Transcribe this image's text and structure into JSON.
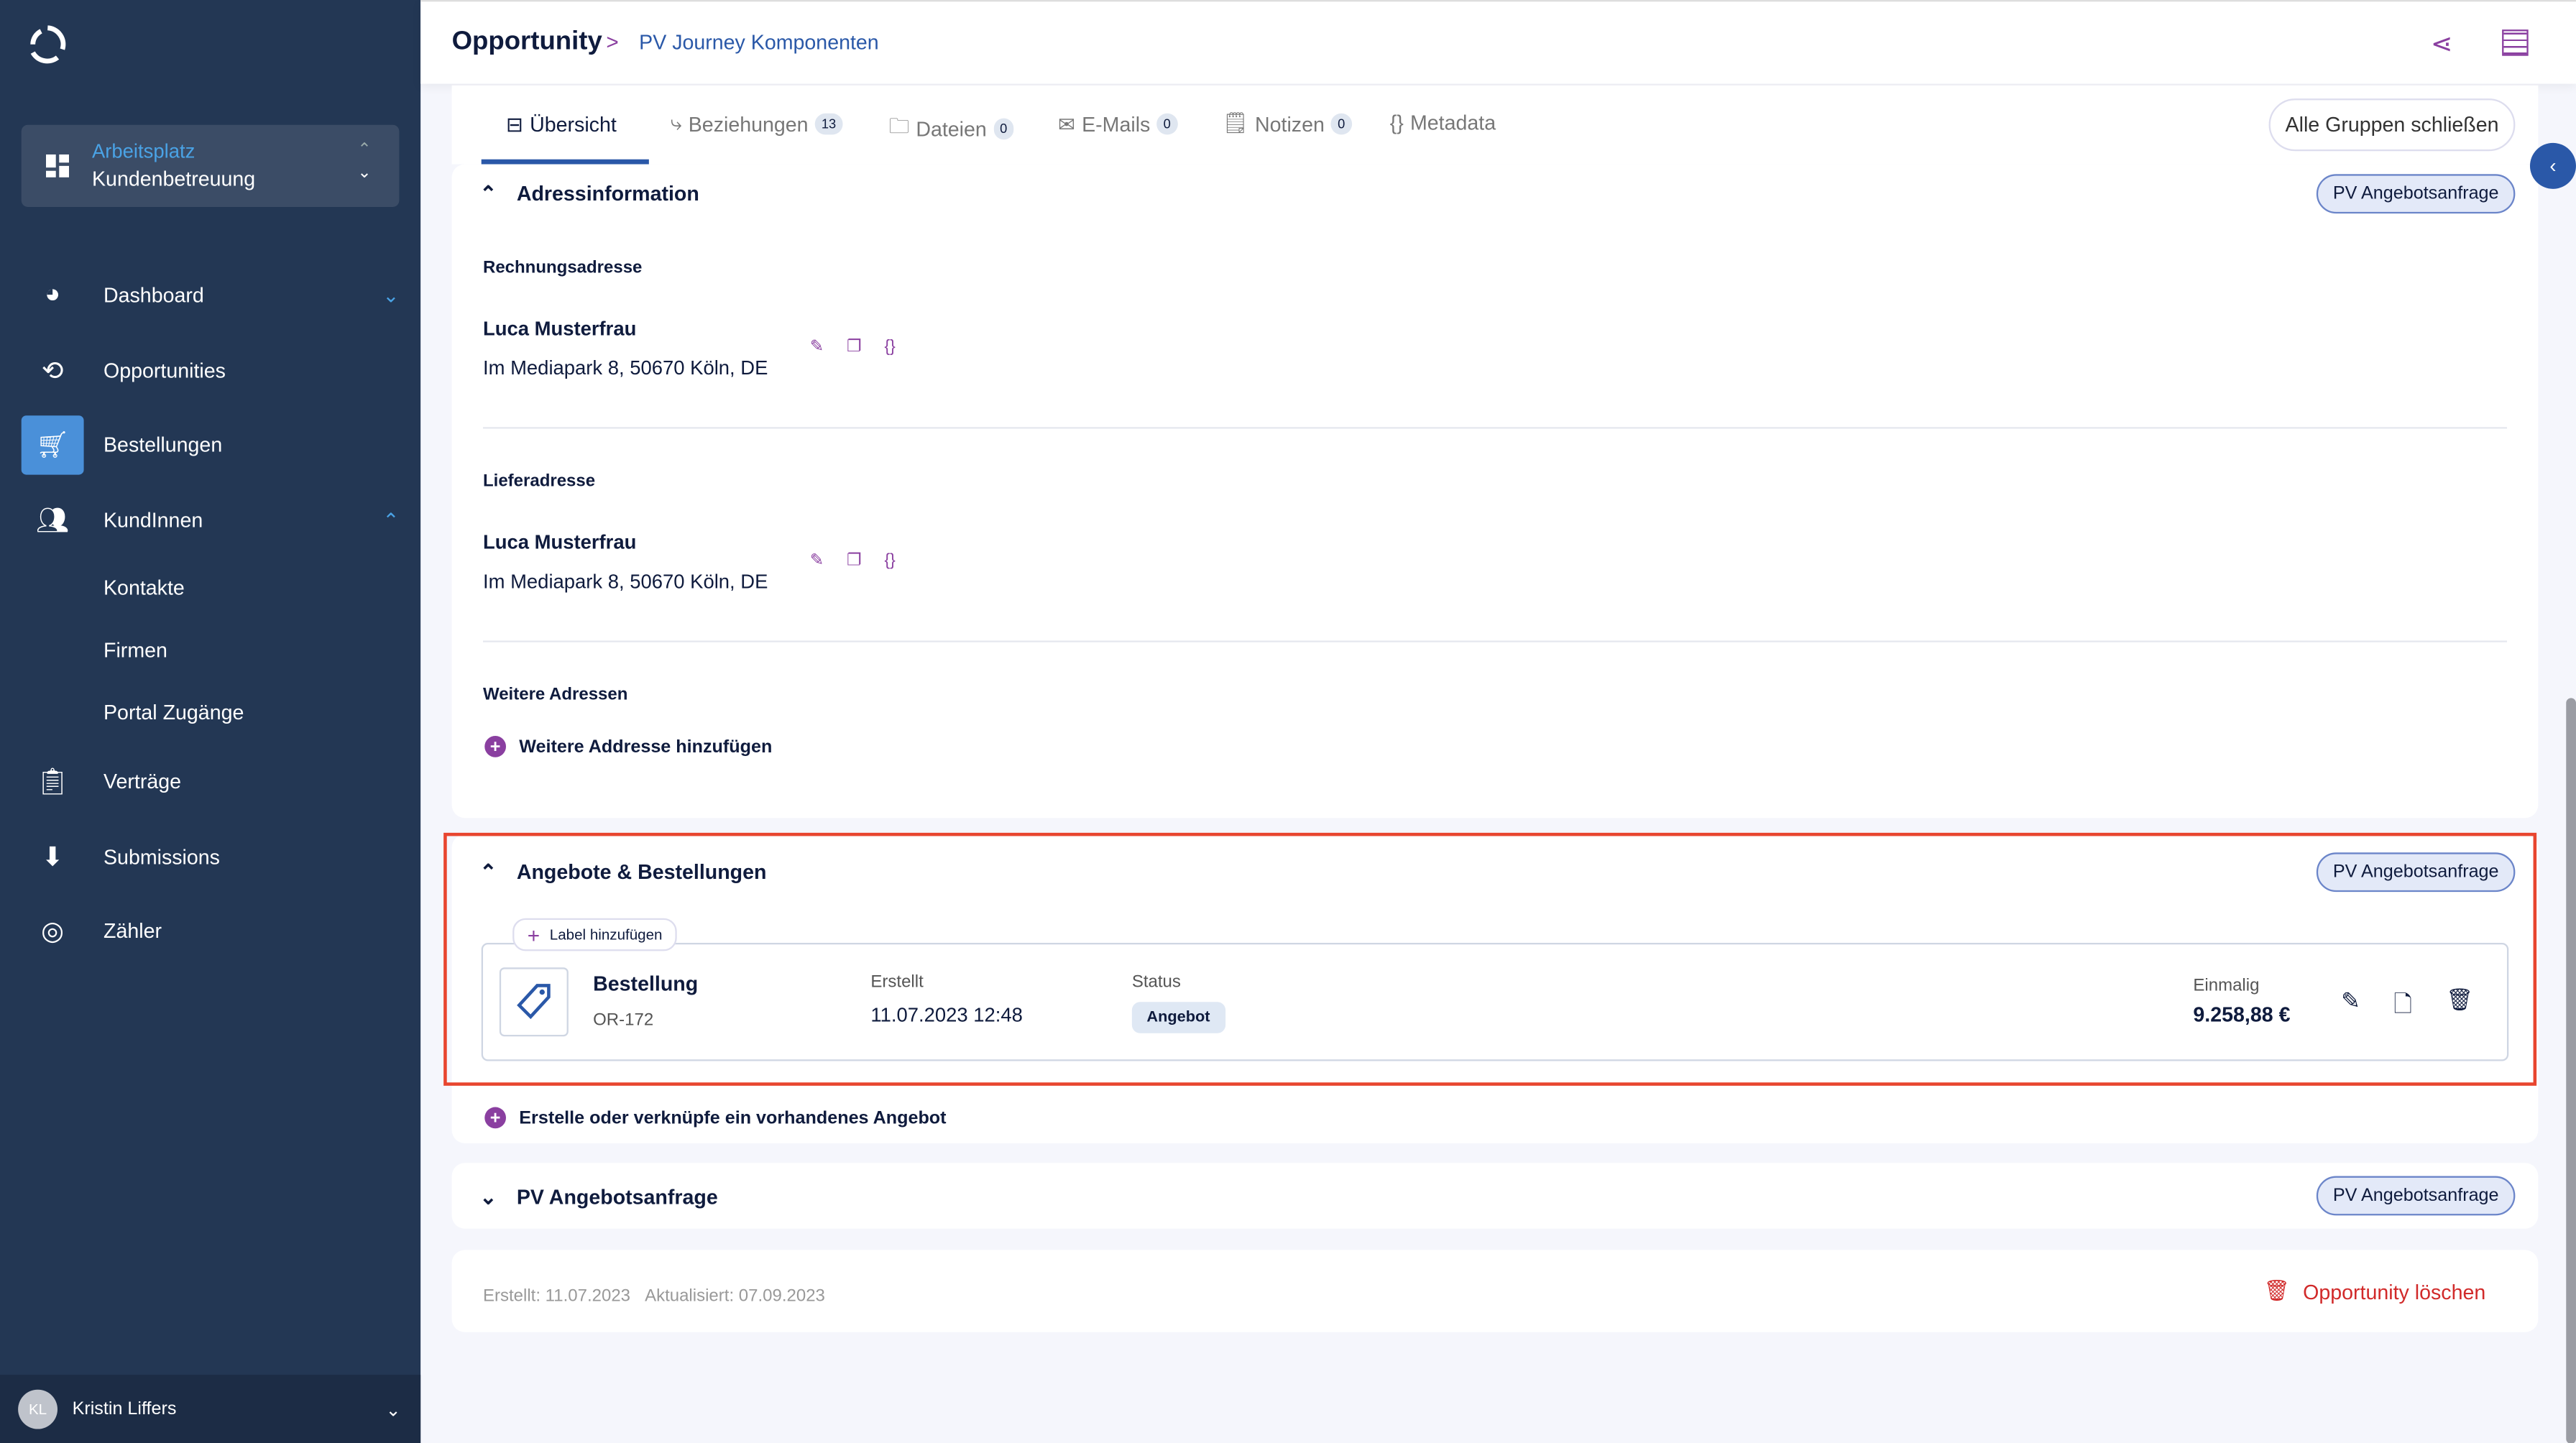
{
  "sidebar": {
    "workspace": {
      "label": "Arbeitsplatz",
      "value": "Kundenbetreuung"
    },
    "items": [
      {
        "label": "Dashboard",
        "icon": "pie-chart-icon"
      },
      {
        "label": "Opportunities",
        "icon": "refresh-icon"
      },
      {
        "label": "Bestellungen",
        "icon": "cart-icon"
      },
      {
        "label": "KundInnen",
        "icon": "users-icon"
      },
      {
        "label": "Verträge",
        "icon": "clipboard-icon"
      },
      {
        "label": "Submissions",
        "icon": "inbox-icon"
      },
      {
        "label": "Zähler",
        "icon": "meter-icon"
      }
    ],
    "subitems": [
      "Kontakte",
      "Firmen",
      "Portal Zugänge"
    ],
    "user": {
      "initials": "KL",
      "name": "Kristin Liffers"
    }
  },
  "header": {
    "breadcrumb_root": "Opportunity",
    "breadcrumb_current": "PV Journey Komponenten"
  },
  "tabs": [
    {
      "label": "Übersicht"
    },
    {
      "label": "Beziehungen",
      "count": "13"
    },
    {
      "label": "Dateien",
      "count": "0"
    },
    {
      "label": "E-Mails",
      "count": "0"
    },
    {
      "label": "Notizen",
      "count": "0"
    },
    {
      "label": "Metadata"
    }
  ],
  "close_groups": "Alle Gruppen schließen",
  "address": {
    "title": "Adressinformation",
    "pill": "PV Angebotsanfrage",
    "billing_label": "Rechnungsadresse",
    "billing_name": "Luca Musterfrau",
    "billing_addr": "Im Mediapark 8, 50670 Köln, DE",
    "delivery_label": "Lieferadresse",
    "delivery_name": "Luca Musterfrau",
    "delivery_addr": "Im Mediapark 8, 50670 Köln, DE",
    "more_label": "Weitere Adressen",
    "add_more": "Weitere Addresse hinzufügen"
  },
  "offers": {
    "title": "Angebote & Bestellungen",
    "pill": "PV Angebotsanfrage",
    "add_label": "Label hinzufügen",
    "order": {
      "type": "Bestellung",
      "id": "OR-172",
      "created_label": "Erstellt",
      "created": "11.07.2023 12:48",
      "status_label": "Status",
      "status": "Angebot",
      "amount_label": "Einmalig",
      "amount": "9.258,88 €"
    },
    "create_link": "Erstelle oder verknüpfe ein vorhandenes Angebot"
  },
  "pv": {
    "title": "PV Angebotsanfrage",
    "pill": "PV Angebotsanfrage"
  },
  "footer": {
    "created": "Erstellt: 11.07.2023",
    "updated": "Aktualisiert: 07.09.2023",
    "delete": "Opportunity löschen"
  },
  "colors": {
    "sidebar": "#233754",
    "accent": "#8a3fa0",
    "primary": "#2a58a8",
    "danger": "#d12a2a",
    "highlight": "#e8452f"
  }
}
